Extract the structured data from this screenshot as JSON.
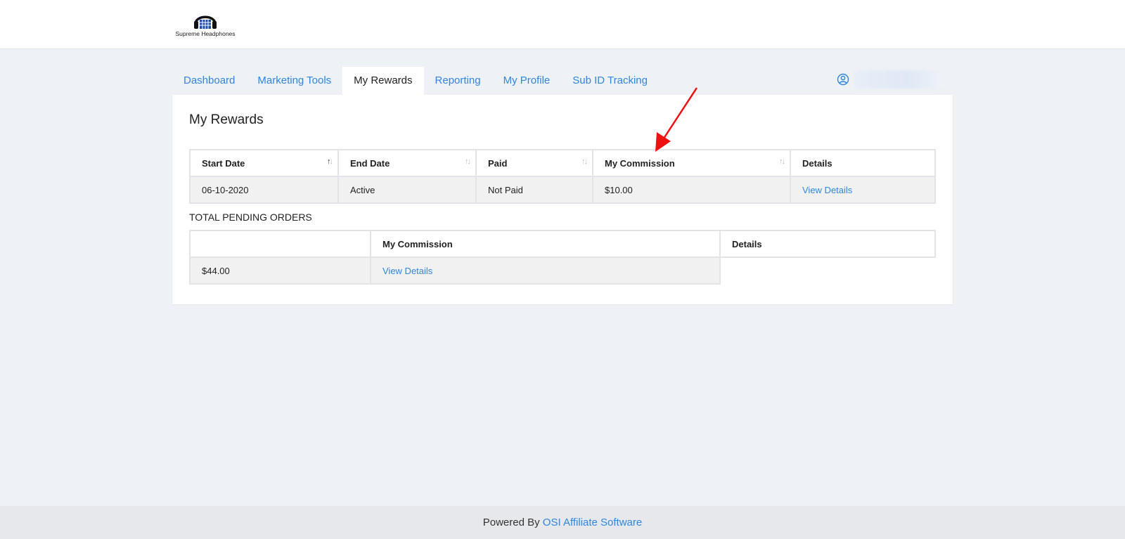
{
  "brand": {
    "logo_text": "Supreme Headphones"
  },
  "nav": {
    "tabs": [
      {
        "label": "Dashboard"
      },
      {
        "label": "Marketing Tools"
      },
      {
        "label": "My Rewards"
      },
      {
        "label": "Reporting"
      },
      {
        "label": "My Profile"
      },
      {
        "label": "Sub ID Tracking"
      }
    ],
    "active_tab": "My Rewards"
  },
  "page": {
    "title": "My Rewards"
  },
  "rewards_table": {
    "headers": [
      "Start Date",
      "End Date",
      "Paid",
      "My Commission",
      "Details"
    ],
    "rows": [
      {
        "start_date": "06-10-2020",
        "end_date": "Active",
        "paid": "Not Paid",
        "commission": "$10.00",
        "details": "View Details"
      }
    ]
  },
  "pending": {
    "label": "TOTAL PENDING ORDERS",
    "headers": [
      "",
      "My Commission",
      "Details"
    ],
    "rows": [
      {
        "amount": "$44.00",
        "details": "View Details"
      }
    ]
  },
  "footer": {
    "prefix": "Powered By ",
    "link": "OSI Affiliate Software"
  },
  "icons": {
    "user": "user-circle-icon",
    "sort": "sort-arrows-icon",
    "annotation": "red-arrow-annotation"
  },
  "colors": {
    "accent": "#2e86de",
    "annotation": "#ee1111"
  }
}
